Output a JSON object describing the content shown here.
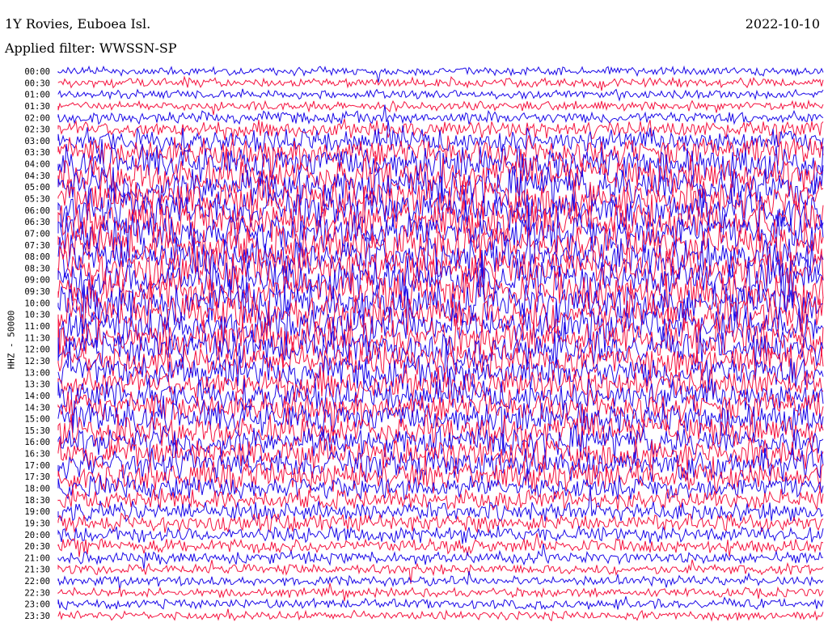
{
  "header": {
    "station": "1Y Rovies, Euboea Isl.",
    "filter": "Applied filter: WWSSN-SP",
    "date": "2022-10-10"
  },
  "side_label": "HHZ - 50000",
  "colors": {
    "trace_a": "#1a08e8",
    "trace_b": "#f5133f",
    "background": "#ffffff",
    "text": "#000000"
  },
  "chart_data": {
    "type": "line",
    "title": "1Y Rovies, Euboea Isl.",
    "subtitle": "Applied filter: WWSSN-SP",
    "date": "2022-10-10",
    "ylabel": "HHZ - 50000",
    "row_labels": [
      "00:00",
      "00:30",
      "01:00",
      "01:30",
      "02:00",
      "02:30",
      "03:00",
      "03:30",
      "04:00",
      "04:30",
      "05:00",
      "05:30",
      "06:00",
      "06:30",
      "07:00",
      "07:30",
      "08:00",
      "08:30",
      "09:00",
      "09:30",
      "10:00",
      "10:30",
      "11:00",
      "11:30",
      "12:00",
      "12:30",
      "13:00",
      "13:30",
      "14:00",
      "14:30",
      "15:00",
      "15:30",
      "16:00",
      "16:30",
      "17:00",
      "17:30",
      "18:00",
      "18:30",
      "19:00",
      "19:30",
      "20:00",
      "20:30",
      "21:00",
      "21:30",
      "22:00",
      "22:30",
      "23:00",
      "23:30"
    ],
    "row_colors": [
      "trace_a",
      "trace_b"
    ],
    "amplitude": [
      0.12,
      0.14,
      0.12,
      0.14,
      0.22,
      0.36,
      0.55,
      0.72,
      0.85,
      0.9,
      0.95,
      0.95,
      1.0,
      1.0,
      1.0,
      1.0,
      1.0,
      1.0,
      1.0,
      1.0,
      1.0,
      0.95,
      0.92,
      0.9,
      0.85,
      0.8,
      0.78,
      0.78,
      0.75,
      0.75,
      0.78,
      0.75,
      0.72,
      0.72,
      0.75,
      0.72,
      0.55,
      0.45,
      0.42,
      0.38,
      0.34,
      0.28,
      0.22,
      0.18,
      0.15,
      0.14,
      0.16,
      0.14
    ],
    "grid": false,
    "legend": "none"
  }
}
